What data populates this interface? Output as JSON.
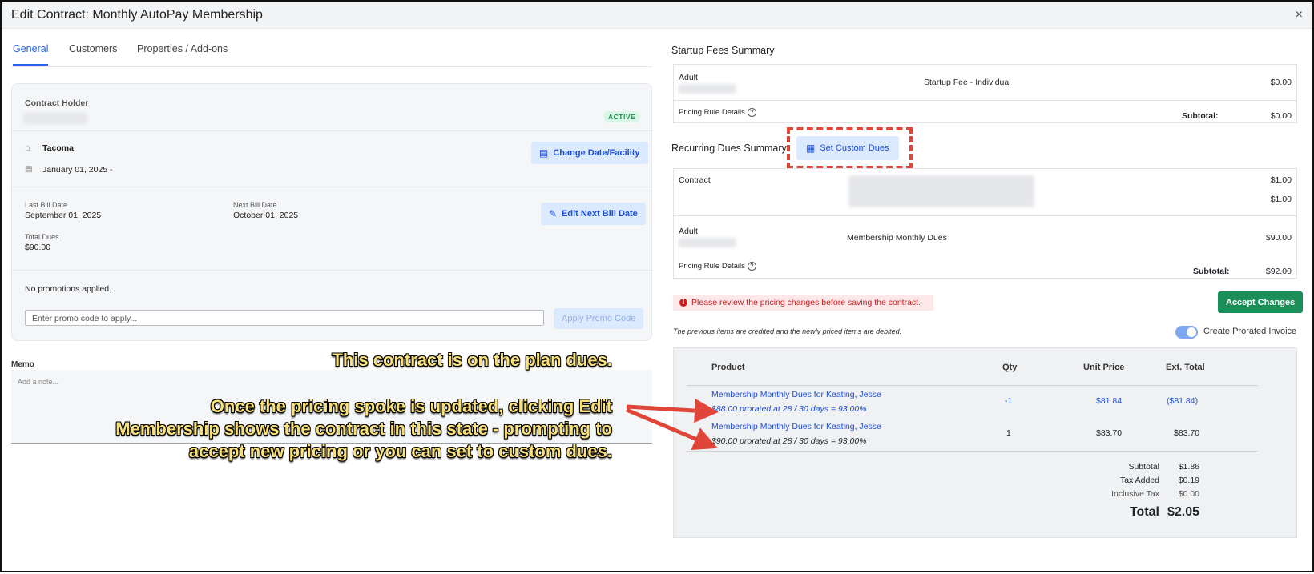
{
  "window": {
    "title": "Edit Contract: Monthly AutoPay Membership",
    "close": "×"
  },
  "tabs": [
    "General",
    "Customers",
    "Properties / Add-ons"
  ],
  "holder": {
    "label": "Contract Holder",
    "status": "ACTIVE",
    "facility": "Tacoma",
    "date": "January 01, 2025 -",
    "change_btn": "Change Date/Facility",
    "last_bill_label": "Last Bill Date",
    "last_bill": "September 01, 2025",
    "next_bill_label": "Next Bill Date",
    "next_bill": "October 01, 2025",
    "edit_next_btn": "Edit Next Bill Date",
    "total_dues_label": "Total Dues",
    "total_dues": "$90.00",
    "promos": "No promotions applied.",
    "promo_placeholder": "Enter promo code to apply...",
    "apply_btn": "Apply Promo Code"
  },
  "memo": {
    "label": "Memo",
    "placeholder": "Add a note..."
  },
  "startup": {
    "title": "Startup Fees Summary",
    "who": "Adult",
    "item": "Startup Fee - Individual",
    "amount": "$0.00",
    "pricing_rule": "Pricing Rule Details",
    "subtotal_label": "Subtotal:",
    "subtotal": "$0.00"
  },
  "recurring": {
    "title": "Recurring Dues Summary",
    "custom_btn": "Set Custom Dues",
    "contract_label": "Contract",
    "contract_amt1": "$1.00",
    "contract_amt2": "$1.00",
    "who": "Adult",
    "item": "Membership Monthly Dues",
    "amount": "$90.00",
    "pricing_rule": "Pricing Rule Details",
    "subtotal_label": "Subtotal:",
    "subtotal": "$92.00"
  },
  "alert": "Please review the pricing changes before saving the contract.",
  "accept_btn": "Accept Changes",
  "note": "The previous items are credited and the newly priced items are debited.",
  "toggle_label": "Create Prorated Invoice",
  "invoice": {
    "headers": {
      "product": "Product",
      "qty": "Qty",
      "unit": "Unit Price",
      "ext": "Ext. Total"
    },
    "rows": [
      {
        "product": "Membership Monthly Dues for Keating, Jesse",
        "detail": "$88.00 prorated at 28 / 30 days = 93.00%",
        "qty": "-1",
        "unit": "$81.84",
        "ext": "($81.84)"
      },
      {
        "product": "Membership Monthly Dues for Keating, Jesse",
        "detail": "$90.00 prorated at 28 / 30 days = 93.00%",
        "qty": "1",
        "unit": "$83.70",
        "ext": "$83.70"
      }
    ],
    "subtotal_label": "Subtotal",
    "subtotal": "$1.86",
    "tax_label": "Tax Added",
    "tax": "$0.19",
    "incl_label": "Inclusive Tax",
    "incl": "$0.00",
    "total_label": "Total",
    "total": "$2.05"
  },
  "callouts": {
    "first": "This contract is on the plan dues.",
    "second_l1": "Once the pricing spoke is updated, clicking Edit",
    "second_l2": "Membership shows the contract in this state - prompting to",
    "second_l3": "accept new pricing or you can set to custom dues."
  },
  "colors": {
    "accent": "#2563eb",
    "success": "#1a8f5a",
    "danger": "#c81e1e",
    "callout": "#f8e07a",
    "arrow": "#e0453a"
  }
}
